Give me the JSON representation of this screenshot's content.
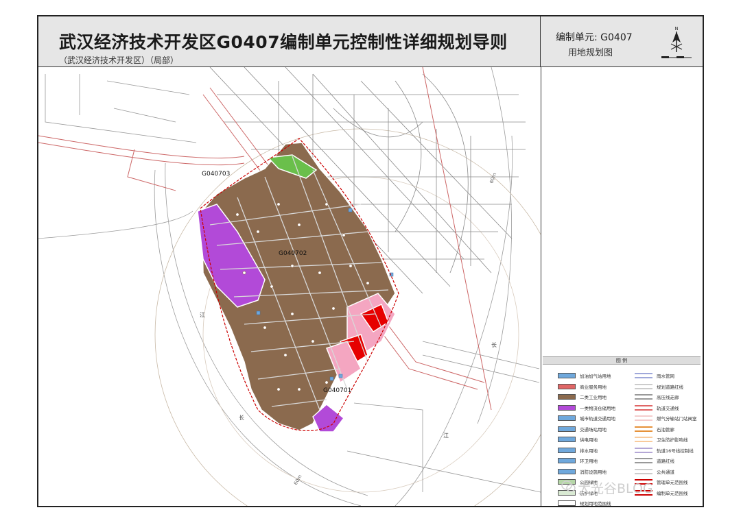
{
  "header": {
    "title": "武汉经济技术开发区G0407编制单元控制性详细规划导则",
    "subtitle": "（武汉经济技术开发区）（局部）"
  },
  "side_header": {
    "unit_label": "编制单元: G0407",
    "map_name": "用地规划图",
    "compass_letter": "N"
  },
  "map": {
    "sub_units": [
      "G040703",
      "G040702",
      "G040701"
    ],
    "river_labels": [
      "江",
      "长",
      "长",
      "江"
    ],
    "road_label": "60m"
  },
  "legend": {
    "title": "图 例",
    "left_items": [
      {
        "label": "加油加气站用地",
        "color": "#6fa8dc"
      },
      {
        "label": "商业服务用地",
        "color": "#e06666"
      },
      {
        "label": "二类工业用地",
        "color": "#8b6a4e"
      },
      {
        "label": "一类物流仓储用地",
        "color": "#b24ad8"
      },
      {
        "label": "城市轨道交通用地",
        "color": "#6fa8dc"
      },
      {
        "label": "交通场站用地",
        "color": "#6fa8dc"
      },
      {
        "label": "供电用地",
        "color": "#6fa8dc"
      },
      {
        "label": "排水用地",
        "color": "#6fa8dc"
      },
      {
        "label": "环卫用地",
        "color": "#6fa8dc"
      },
      {
        "label": "消防设施用地",
        "color": "#6fa8dc"
      },
      {
        "label": "公园绿地",
        "color": "#b6d7a8"
      },
      {
        "label": "防护绿地",
        "color": "#d9ead3"
      }
    ],
    "right_items": [
      {
        "label": "雨水管网",
        "color": "#9fa8da"
      },
      {
        "label": "规划道路红线",
        "color": "#cccccc"
      },
      {
        "label": "高压线走廊",
        "color": "#999999"
      },
      {
        "label": "轨道交通线",
        "color": "#e06666"
      },
      {
        "label": "燃气分输站门站阀室",
        "color": "#f4cccc"
      },
      {
        "label": "石油管廊",
        "color": "#e69138"
      },
      {
        "label": "卫生防护影响线",
        "color": "#f9cb9c"
      },
      {
        "label": "轨道16号线控制线",
        "color": "#b4a7d6"
      },
      {
        "label": "道路红线",
        "color": "#999999"
      },
      {
        "label": "公共通道",
        "color": "#cccccc"
      },
      {
        "label": "管理单元范围线",
        "color": "#cc0000"
      },
      {
        "label": "编制单元范围线",
        "color": "#cc0000"
      }
    ],
    "bottom_items": [
      {
        "label": "规划用地范围线",
        "color": "#ffffff"
      }
    ]
  },
  "watermark": "大光谷BLOG",
  "colors": {
    "industrial": "#8b6a4e",
    "logistics": "#b24ad8",
    "commercial_red": "#e60000",
    "commercial_pink": "#f4a6c1",
    "green": "#6abf4b",
    "road": "#888888",
    "boundary": "#cc0000"
  }
}
